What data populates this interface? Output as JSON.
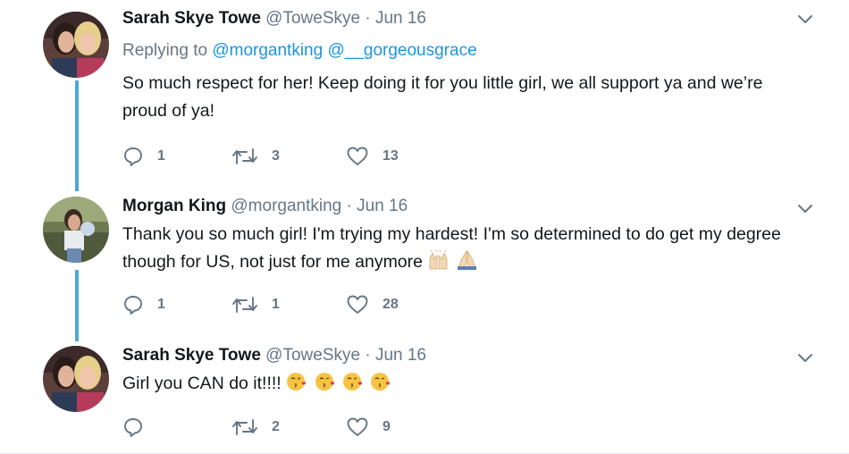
{
  "thread": {
    "tweets": [
      {
        "name": "Sarah Skye Towe",
        "handle": "@ToweSkye",
        "separator": "·",
        "date": "Jun 16",
        "replying_prefix": "Replying to",
        "replying_users": [
          "@morgantking",
          "@__gorgeousgrace"
        ],
        "text": "So much respect for her! Keep doing it for you little girl, we all support ya and we’re proud of ya!",
        "replies": "1",
        "retweets": "3",
        "likes": "13"
      },
      {
        "name": "Morgan King",
        "handle": "@morgantking",
        "separator": "·",
        "date": "Jun 16",
        "text": "Thank you so much girl! I'm trying my hardest! I'm so determined to do get my degree though for US, not just for me anymore",
        "emojis": [
          "raising-hands-emoji",
          "folded-hands-emoji"
        ],
        "replies": "1",
        "retweets": "1",
        "likes": "28"
      },
      {
        "name": "Sarah Skye Towe",
        "handle": "@ToweSkye",
        "separator": "·",
        "date": "Jun 16",
        "text": "Girl you CAN do it!!!!",
        "emojis": [
          "kissing-face-emoji",
          "kissing-face-emoji",
          "kissing-face-emoji",
          "kissing-face-emoji"
        ],
        "replies": "",
        "retweets": "2",
        "likes": "9"
      }
    ]
  },
  "colors": {
    "link": "#1b95e0",
    "secondary_text": "#657786",
    "primary_text": "#14171a",
    "thread_line": "#4aa8d6"
  },
  "icons": {
    "reply": "reply-icon",
    "retweet": "retweet-icon",
    "like": "heart-icon",
    "more": "chevron-down-icon"
  }
}
